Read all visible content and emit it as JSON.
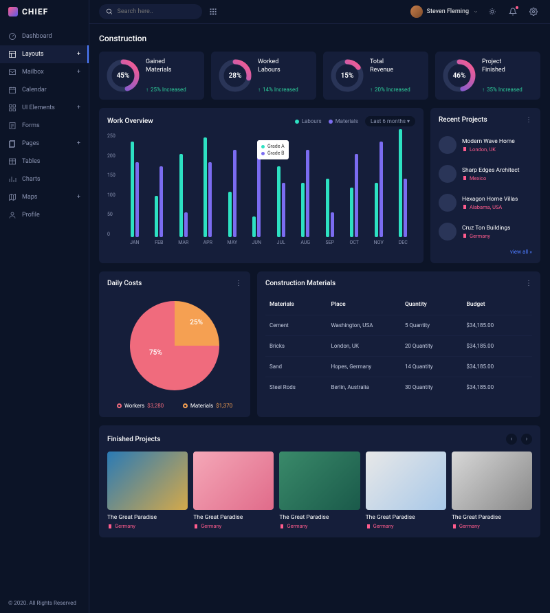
{
  "brand": "CHIEF",
  "search": {
    "placeholder": "Search here.."
  },
  "user": {
    "name": "Steven Fleming"
  },
  "nav": [
    {
      "label": "Dashboard",
      "icon": "speedometer"
    },
    {
      "label": "Layouts",
      "icon": "layout",
      "active": true,
      "expandable": true
    },
    {
      "label": "Mailbox",
      "icon": "mail",
      "expandable": true
    },
    {
      "label": "Calendar",
      "icon": "calendar"
    },
    {
      "label": "UI Elements",
      "icon": "grid",
      "expandable": true
    },
    {
      "label": "Forms",
      "icon": "form"
    },
    {
      "label": "Pages",
      "icon": "pages",
      "expandable": true
    },
    {
      "label": "Tables",
      "icon": "table"
    },
    {
      "label": "Charts",
      "icon": "chart"
    },
    {
      "label": "Maps",
      "icon": "map",
      "expandable": true
    },
    {
      "label": "Profile",
      "icon": "profile"
    }
  ],
  "footer": "© 2020. All Rights Reserved",
  "page_title": "Construction",
  "stats": [
    {
      "pct": "45%",
      "title": "Gained Materials",
      "trend": "25% Increased",
      "value": 45
    },
    {
      "pct": "28%",
      "title": "Worked Labours",
      "trend": "14% Increased",
      "value": 28
    },
    {
      "pct": "15%",
      "title": "Total Revenue",
      "trend": "20% Increased",
      "value": 15
    },
    {
      "pct": "46%",
      "title": "Project Finished",
      "trend": "35% Increased",
      "value": 46
    }
  ],
  "overview": {
    "title": "Work Overview",
    "legend": {
      "a": "Labours",
      "b": "Materials"
    },
    "range": "Last 6 months",
    "tooltip": {
      "a": "Grade A",
      "b": "Grade B"
    }
  },
  "chart_data": {
    "type": "bar",
    "categories": [
      "JAN",
      "FEB",
      "MAR",
      "APR",
      "MAY",
      "JUN",
      "JUL",
      "AUG",
      "SEP",
      "OCT",
      "NOV",
      "DEC"
    ],
    "series": [
      {
        "name": "Labours",
        "values": [
          230,
          100,
          200,
          240,
          110,
          50,
          170,
          130,
          140,
          120,
          130,
          260
        ]
      },
      {
        "name": "Materials",
        "values": [
          180,
          170,
          60,
          180,
          210,
          220,
          130,
          210,
          60,
          200,
          230,
          140
        ]
      }
    ],
    "ylim": [
      0,
      250
    ],
    "y_ticks": [
      0,
      50,
      100,
      150,
      200,
      250
    ]
  },
  "recent": {
    "title": "Recent Projects",
    "items": [
      {
        "name": "Modern Wave Home",
        "loc": "London, UK"
      },
      {
        "name": "Sharp Edges Architect",
        "loc": "Mexico"
      },
      {
        "name": "Hexagon Home Villas",
        "loc": "Alabama, USA"
      },
      {
        "name": "Cruz Ton Buildings",
        "loc": "Germany"
      }
    ],
    "view_all": "view all »"
  },
  "daily": {
    "title": "Daily Costs",
    "slices": [
      {
        "label": "25%",
        "pct": 25
      },
      {
        "label": "75%",
        "pct": 75
      }
    ],
    "legend": [
      {
        "name": "Workers",
        "val": "$3,280",
        "color": "#f06b7d"
      },
      {
        "name": "Materials",
        "val": "$1,370",
        "color": "#f5a052"
      }
    ]
  },
  "materials": {
    "title": "Construction Materials",
    "cols": [
      "Materials",
      "Place",
      "Quantity",
      "Budget"
    ],
    "rows": [
      [
        "Cement",
        "Washington, USA",
        "5 Quantity",
        "$34,185.00"
      ],
      [
        "Bricks",
        "London, UK",
        "20 Quantity",
        "$34,185.00"
      ],
      [
        "Sand",
        "Hopes, Germany",
        "14 Quantity",
        "$34,185.00"
      ],
      [
        "Steel Rods",
        "Berlin, Australia",
        "30 Quantity",
        "$34,185.00"
      ]
    ]
  },
  "finished": {
    "title": "Finished Projects",
    "items": [
      {
        "title": "The Great Paradise",
        "loc": "Germany",
        "bg": "linear-gradient(135deg,#2a7ab5,#d4a94a)"
      },
      {
        "title": "The Great Paradise",
        "loc": "Germany",
        "bg": "linear-gradient(135deg,#f5a8b8,#e06b8a)"
      },
      {
        "title": "The Great Paradise",
        "loc": "Germany",
        "bg": "linear-gradient(135deg,#3a8a6a,#1a5a4a)"
      },
      {
        "title": "The Great Paradise",
        "loc": "Germany",
        "bg": "linear-gradient(135deg,#e8e8e8,#a8c8e8)"
      },
      {
        "title": "The Great Paradise",
        "loc": "Germany",
        "bg": "linear-gradient(135deg,#d8d8d8,#888888)"
      }
    ]
  }
}
